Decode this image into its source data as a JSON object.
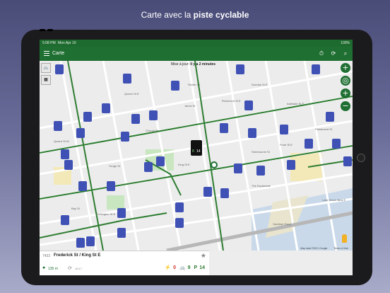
{
  "caption": {
    "prefix": "Carte avec la ",
    "bold": "piste cyclable"
  },
  "status_bar": {
    "time": "5:08 PM",
    "date": "Mon Apr 10",
    "battery": "100%"
  },
  "app_bar": {
    "title": "Carte"
  },
  "map": {
    "update_prefix": "Mise à jour: ",
    "update_value": "il y a 2 minutes",
    "map_data": "Map data ©2021 Google",
    "terms": "Terms of Use",
    "highlighted_station": {
      "bikes": "8",
      "docks": "14"
    },
    "street_labels": [
      "Queen St E",
      "Richmond St E",
      "Adelaide St E",
      "King St E",
      "Front St E",
      "Wellington St E",
      "The Esplanade",
      "Gardiner Expy",
      "Lake Shore Blvd E",
      "Parliament St",
      "Sherbourne St",
      "Jarvis St",
      "Church St",
      "Yonge St",
      "Bay St",
      "Dundas St E",
      "Shuter St",
      "Queen St W"
    ],
    "colors": {
      "bike_lane": "#2e7d32",
      "station": "#3f51b5",
      "app_green": "#1f6f32"
    }
  },
  "station_panel": {
    "id": "7432",
    "name": "Frederick St / King St E",
    "distance": "135 m",
    "time": "16:17",
    "ebikes": "0",
    "bikes": "9",
    "docks": "14"
  }
}
